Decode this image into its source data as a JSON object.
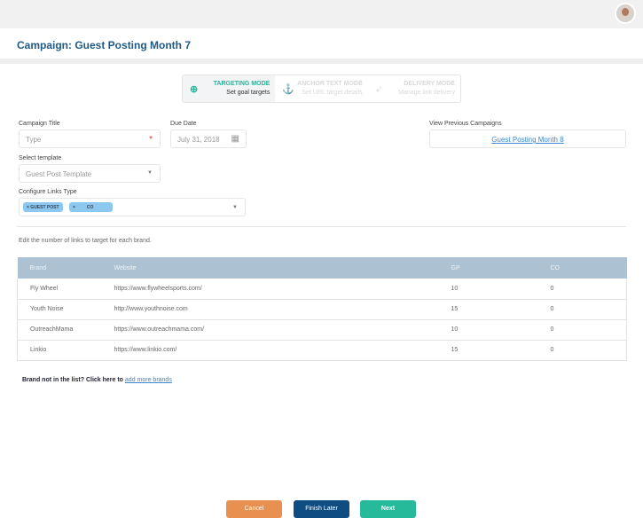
{
  "header": {
    "title": "Campaign: Guest Posting Month 7"
  },
  "stepper": [
    {
      "title": "TARGETING MODE",
      "subtitle": "Set goal targets",
      "icon": "crosshair-icon"
    },
    {
      "title": "ANCHOR TEXT MODE",
      "subtitle": "Set URL target details",
      "icon": "anchor-icon"
    },
    {
      "title": "DELIVERY MODE",
      "subtitle": "Manage link delivery",
      "icon": "rocket-icon"
    }
  ],
  "form": {
    "campaign_title_label": "Campaign Title",
    "campaign_title_placeholder": "Type",
    "required_mark": "*",
    "due_date_label": "Due Date",
    "due_date_value": "July 31, 2018",
    "template_label": "Select template",
    "template_value": "Guest Post Template",
    "links_type_label": "Configure Links Type",
    "chips": [
      "× GUEST POST",
      "×",
      "CO"
    ],
    "previous_label": "View Previous Campaigns",
    "previous_link": "Guest Posting Month 8"
  },
  "table": {
    "note": "Edit the number of links to target for each brand.",
    "headers": [
      "Brand",
      "Website",
      "GP",
      "CO"
    ],
    "rows": [
      [
        "Fly Wheel",
        "https://www.flywheelsports.com/",
        "10",
        "0"
      ],
      [
        "Youth Noise",
        "http://www.youthnoise.com",
        "15",
        "0"
      ],
      [
        "OutreachMama",
        "https://www.outreachmama.com/",
        "10",
        "0"
      ],
      [
        "Linkio",
        "https://www.linkio.com/",
        "15",
        "0"
      ]
    ]
  },
  "footer": {
    "brand_note": "Brand not in the list? Click here to ",
    "add_link": "add more brands",
    "cancel": "Cancel",
    "finish_later": "Finish Later",
    "next": "Next"
  },
  "colors": {
    "cancel": "#e8904f",
    "finish": "#0f4c81",
    "next": "#26b99a",
    "accent": "#2bb39a"
  }
}
